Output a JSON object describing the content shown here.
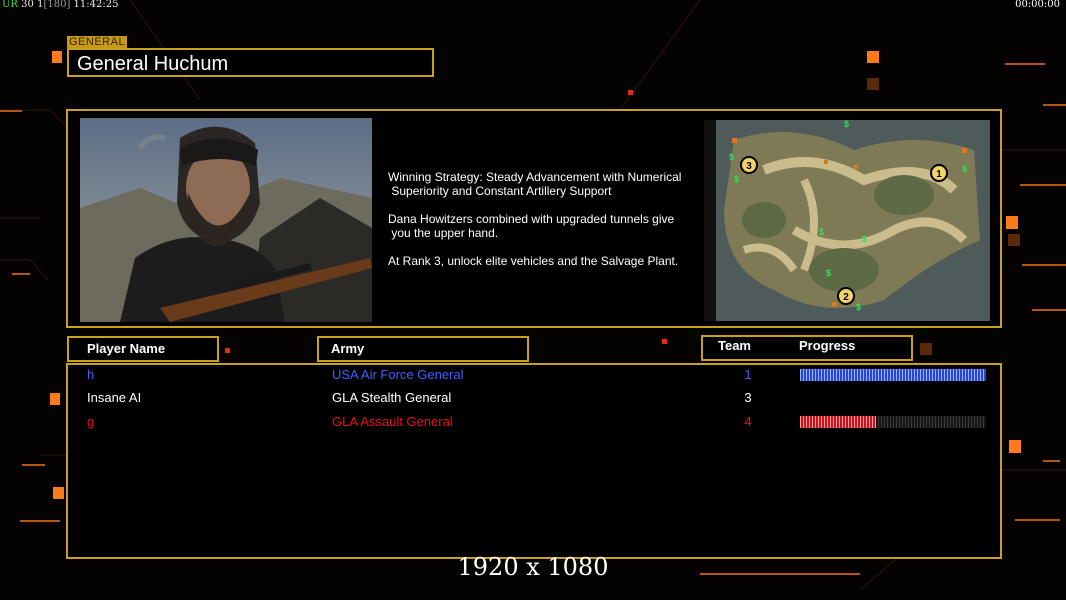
{
  "hud": {
    "prefix": "UR",
    "fps": "30",
    "counter": "1",
    "bracket_value": "[180]",
    "clock": "11:42:25",
    "timer": "00:00:00"
  },
  "general": {
    "tag": "GENERAL",
    "name": "General Huchum",
    "strategy": [
      "Winning Strategy: Steady Advancement with Numerical\n Superiority and Constant Artillery Support",
      "Dana Howitzers combined with upgraded tunnels give\n you the upper hand.",
      "At Rank 3, unlock elite vehicles and the Salvage Plant."
    ]
  },
  "minimap": {
    "start_positions": [
      "1",
      "2",
      "3"
    ]
  },
  "table": {
    "headers": {
      "player": "Player Name",
      "army": "Army",
      "team": "Team",
      "progress": "Progress"
    },
    "rows": [
      {
        "name": "h",
        "army": "USA Air Force General",
        "team": "1",
        "color": "#3b62ff",
        "progress": 1.0,
        "fill": "blue"
      },
      {
        "name": "Insane AI",
        "army": "GLA Stealth General",
        "team": "3",
        "color": "#ffffff",
        "progress": null,
        "fill": "none"
      },
      {
        "name": "g",
        "army": "GLA Assault General",
        "team": "4",
        "color": "#e8101a",
        "progress": 0.41,
        "fill": "red"
      }
    ]
  },
  "resolution_caption": "1920 x 1080",
  "colors": {
    "frame": "#c9a11b",
    "accent_orange": "#ff7a1a"
  }
}
